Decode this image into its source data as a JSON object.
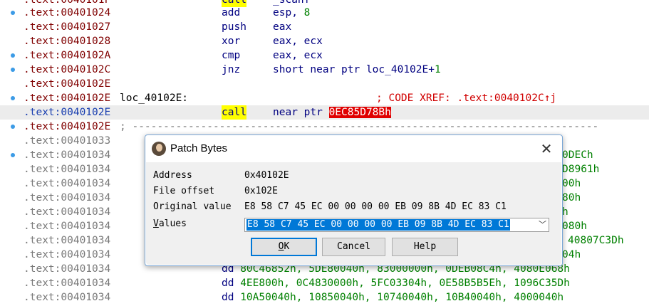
{
  "listing": {
    "top_cut": {
      "addr": ".text:0040101F",
      "mn": "call",
      "ops": "_scanf"
    },
    "lines": [
      {
        "addr": ".text:00401024",
        "mn": "add",
        "ops": "esp, ",
        "num": "8"
      },
      {
        "addr": ".text:00401027",
        "mn": "push",
        "ops": "eax"
      },
      {
        "addr": ".text:00401028",
        "mn": "xor",
        "ops": "eax, ecx"
      },
      {
        "addr": ".text:0040102A",
        "mn": "cmp",
        "ops": "eax, ecx"
      },
      {
        "addr": ".text:0040102C",
        "mn": "jnz",
        "ops": "short near ptr loc_40102E+",
        "num": "1"
      },
      {
        "addr": ".text:0040102E"
      },
      {
        "addr": ".text:0040102E",
        "label": "loc_40102E:",
        "comment": "; CODE XREF: .text:0040102C↑j"
      },
      {
        "addr": ".text:0040102E",
        "mn": "call",
        "ops": "near ptr ",
        "red": "0EC85D78Bh"
      },
      {
        "addr": ".text:0040102E",
        "sep": "; ---------------------------------------------------------------------------"
      },
      {
        "addr": ".text:00401033"
      },
      {
        "addr": ".text:00401034",
        "right": "0DECh"
      },
      {
        "addr": ".text:00401034",
        "right": "D8961h"
      },
      {
        "addr": ".text:00401034",
        "right": "00h"
      },
      {
        "addr": ".text:00401034",
        "right": "80h"
      },
      {
        "addr": ".text:00401034",
        "right": "h"
      },
      {
        "addr": ".text:00401034",
        "right": "080h"
      },
      {
        "addr": ".text:00401034",
        "right": "40807C3Dh"
      },
      {
        "addr": ".text:00401034",
        "right": "04h"
      },
      {
        "addr": ".text:00401034",
        "dd": "dd",
        "vals": "80C46852h, 5DE80040h, 83000000h, 0DEB08C4h, 4080E068h"
      },
      {
        "addr": ".text:00401034",
        "dd": "dd",
        "vals": "4EE800h, 0C4830000h, 5FC03304h, 0E58B5B5Eh, 1096C35Dh"
      },
      {
        "addr": ".text:00401034",
        "dd": "dd",
        "vals": "10A50040h, 10850040h, 10740040h, 10B40040h, 4000040h"
      }
    ]
  },
  "dialog": {
    "title": "Patch Bytes",
    "close_glyph": "✕",
    "address_label": "Address",
    "address_value": "0x40102E",
    "offset_label": "File offset",
    "offset_value": "0x102E",
    "original_label": "Original value",
    "original_value": "E8 58 C7 45 EC 00 00 00 00 EB 09 8B 4D EC 83 C1",
    "values_label_first": "V",
    "values_label_rest": "alues",
    "values_value": "E8 58 C7 45 EC 00 00 00 00 EB 09 8B 4D EC 83 C1",
    "chevron": "﹀",
    "ok_first": "O",
    "ok_rest": "K",
    "cancel": "Cancel",
    "help": "Help"
  },
  "colors": {
    "breakpoint": "#3c9be6",
    "highlight_yellow": "#ffff00",
    "highlight_red": "#e00000",
    "dialog_border": "#7aa7d6",
    "accent": "#0078d7"
  }
}
